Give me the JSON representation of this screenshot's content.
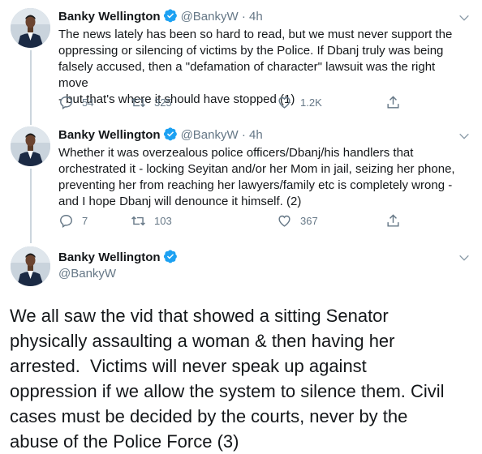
{
  "tweets": [
    {
      "name": "Banky Wellington",
      "handle": "@BankyW",
      "dot": "·",
      "time": "4h",
      "lines": [
        "The news lately has been so hard to read, but we must never support the",
        "oppressing or silencing of victims by the Police. If Dbanj truly was being",
        "falsely accused, then a \"defamation of character\" lawsuit was the right move",
        "- but that's where it should have stopped (1)"
      ],
      "replies": "54",
      "retweets": "325",
      "likes": "1.2K"
    },
    {
      "name": "Banky Wellington",
      "handle": "@BankyW",
      "dot": "·",
      "time": "4h",
      "lines": [
        "Whether it was overzealous police officers/Dbanj/his handlers that",
        "orchestrated it - locking Seyitan and/or her Mom in jail, seizing her phone,",
        "preventing her from reaching her lawyers/family etc is completely wrong -",
        "and I hope Dbanj will denounce it himself. (2)"
      ],
      "replies": "7",
      "retweets": "103",
      "likes": "367"
    }
  ],
  "main_tweet": {
    "name": "Banky Wellington",
    "handle": "@BankyW",
    "lines": [
      "We all saw the vid that showed a sitting Senator",
      "physically assaulting a woman & then having her",
      "arrested.  Victims will never speak up against",
      "oppression if we allow the system to silence them. Civil",
      "cases must be decided by the courts, never by the",
      "abuse of the Police Force (3)"
    ]
  },
  "colors": {
    "verified": "#1da1f2",
    "secondary_text": "#657786",
    "thread_line": "#ccd6dd"
  }
}
